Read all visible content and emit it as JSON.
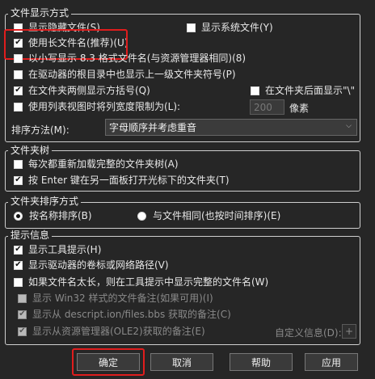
{
  "display": {
    "legend": "文件显示方式",
    "show_hidden": "显示隐藏文件(S)",
    "show_system": "显示系统文件(Y)",
    "long_names": "使用长文件名(推荐)(U)",
    "dos_names": "以小写显示 8.3 格式文件名(与资源管理器相同)(8)",
    "parent_symbol": "在驱动器的根目录中也显示上一级文件夹符号(P)",
    "brackets": "在文件夹两侧显示方括号(Q)",
    "backslash": "在文件夹后面显示\"\\\"",
    "limit_width": "使用列表视图时将列宽度限制为(L):",
    "width_value": "200",
    "width_unit": "像素",
    "sort_label": "排序方法(M):",
    "sort_value": "字母顺序并考虑重音"
  },
  "tree": {
    "legend": "文件夹树",
    "reload": "每次都重新加载完整的文件夹树(A)",
    "enter_open": "按 Enter 键在另一面板打开光标下的文件夹(T)"
  },
  "sort": {
    "legend": "文件夹排序方式",
    "by_name": "按名称排序(B)",
    "by_time": "与文件相同(也按时间排序)(E)"
  },
  "tips": {
    "legend": "提示信息",
    "show_tips": "显示工具提示(H)",
    "show_drive": "显示驱动器的卷标或网络路径(V)",
    "full_name": "如果文件名太长，则在工具提示中显示完整的文件名(W)",
    "win32": "显示 Win32 样式的文件备注(如果可用)(I)",
    "descript": "显示从 descript.ion/files.bbs 获取的备注(C)",
    "ole2": "显示从资源管理器(OLE2)获取的备注(E)",
    "custom": "自定义信息(D):",
    "plus": "+"
  },
  "buttons": {
    "ok": "确定",
    "cancel": "取消",
    "help": "帮助",
    "apply": "应用"
  },
  "colors": {
    "accent_red": "#e01d1d"
  }
}
